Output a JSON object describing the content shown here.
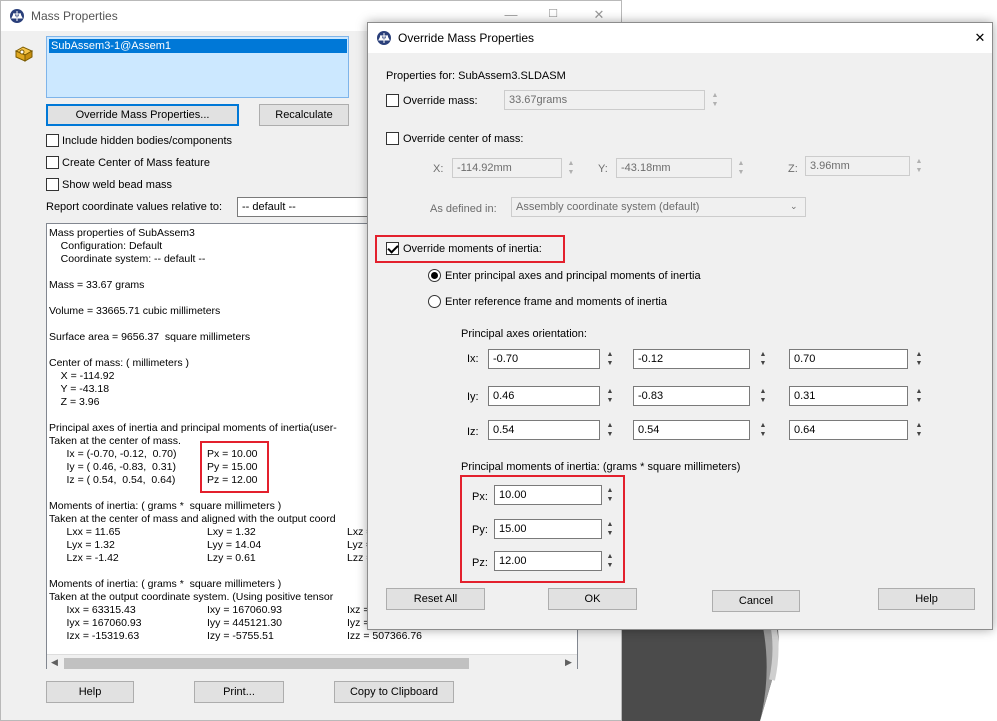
{
  "left_window": {
    "title": "Mass Properties",
    "selection_item": "SubAssem3-1@Assem1",
    "override_button": "Override Mass Properties...",
    "recalculate_button": "Recalculate",
    "chk_hidden": "Include hidden bodies/components",
    "chk_center": "Create Center of Mass feature",
    "chk_weld": "Show weld bead mass",
    "report_label": "Report coordinate values relative to:",
    "report_value": "-- default --",
    "results": [
      "Mass properties of SubAssem3",
      "    Configuration: Default",
      "    Coordinate system: -- default --",
      "",
      "Mass = 33.67 grams",
      "",
      "Volume = 33665.71 cubic millimeters",
      "",
      "Surface area = 9656.37  square millimeters",
      "",
      "Center of mass: ( millimeters )",
      "    X = -114.92",
      "    Y = -43.18",
      "    Z = 3.96",
      "",
      "Principal axes of inertia and principal moments of inertia(user-",
      "Taken at the center of mass.",
      "      Ix = (-0.70, -0.12,  0.70)",
      "      Iy = ( 0.46, -0.83,  0.31)",
      "      Iz = ( 0.54,  0.54,  0.64)",
      "",
      "Moments of inertia: ( grams *  square millimeters )",
      "Taken at the center of mass and aligned with the output coord",
      "      Lxx = 11.65",
      "      Lyx = 1.32",
      "      Lzx = -1.42",
      "",
      "Moments of inertia: ( grams *  square millimeters )",
      "Taken at the output coordinate system. (Using positive tensor",
      "      Ixx = 63315.43",
      "      Iyx = 167060.93",
      "      Izx = -15319.63"
    ],
    "principal_moments": [
      "Px = 10.00",
      "Py = 15.00",
      "Pz = 12.00"
    ],
    "col2_block1": [
      "Lxy = 1.32",
      "Lyy = 14.04",
      "Lzy = 0.61"
    ],
    "col3_block1": [
      "Lxz =",
      "Lyz =",
      "Lzz ="
    ],
    "col2_block2": [
      "Ixy = 167060.93",
      "Iyy = 445121.30",
      "Izy = -5755.51"
    ],
    "col3_block2": [
      "Ixz =",
      "Iyz =",
      "Izz = 507366.76"
    ],
    "help_button": "Help",
    "print_button": "Print...",
    "copy_button": "Copy to Clipboard"
  },
  "dialog": {
    "title": "Override Mass Properties",
    "properties_for": "Properties for: SubAssem3.SLDASM",
    "override_mass_label": "Override mass:",
    "override_mass_value": "33.67grams",
    "override_center_label": "Override center of mass:",
    "x_label": "X:",
    "x_value": "-114.92mm",
    "y_label": "Y:",
    "y_value": "-43.18mm",
    "z_label": "Z:",
    "z_value": "3.96mm",
    "defined_in_label": "As defined in:",
    "defined_in_value": "Assembly coordinate system (default)",
    "override_moments_label": "Override moments of inertia:",
    "radio_principal": "Enter principal axes and principal moments of inertia",
    "radio_reference": "Enter reference frame and moments of inertia",
    "axes_heading": "Principal axes orientation:",
    "axes_rows": [
      {
        "label": "Ix:",
        "values": [
          "-0.70",
          "-0.12",
          "0.70"
        ]
      },
      {
        "label": "Iy:",
        "values": [
          "0.46",
          "-0.83",
          "0.31"
        ]
      },
      {
        "label": "Iz:",
        "values": [
          "0.54",
          "0.54",
          "0.64"
        ]
      }
    ],
    "moments_heading": "Principal moments of inertia: (grams *  square millimeters)",
    "moments_rows": [
      {
        "label": "Px:",
        "value": "10.00"
      },
      {
        "label": "Py:",
        "value": "15.00"
      },
      {
        "label": "Pz:",
        "value": "12.00"
      }
    ],
    "reset_button": "Reset All",
    "ok_button": "OK",
    "cancel_button": "Cancel",
    "help_button": "Help"
  },
  "colors": {
    "highlight_red": "#e3202d",
    "selection_blue": "#0078d7"
  },
  "icons": [
    "scale-icon",
    "component-icon",
    "close-icon",
    "minimize-icon",
    "maximize-icon",
    "spin-arrows-icon",
    "dropdown-arrow-icon"
  ]
}
